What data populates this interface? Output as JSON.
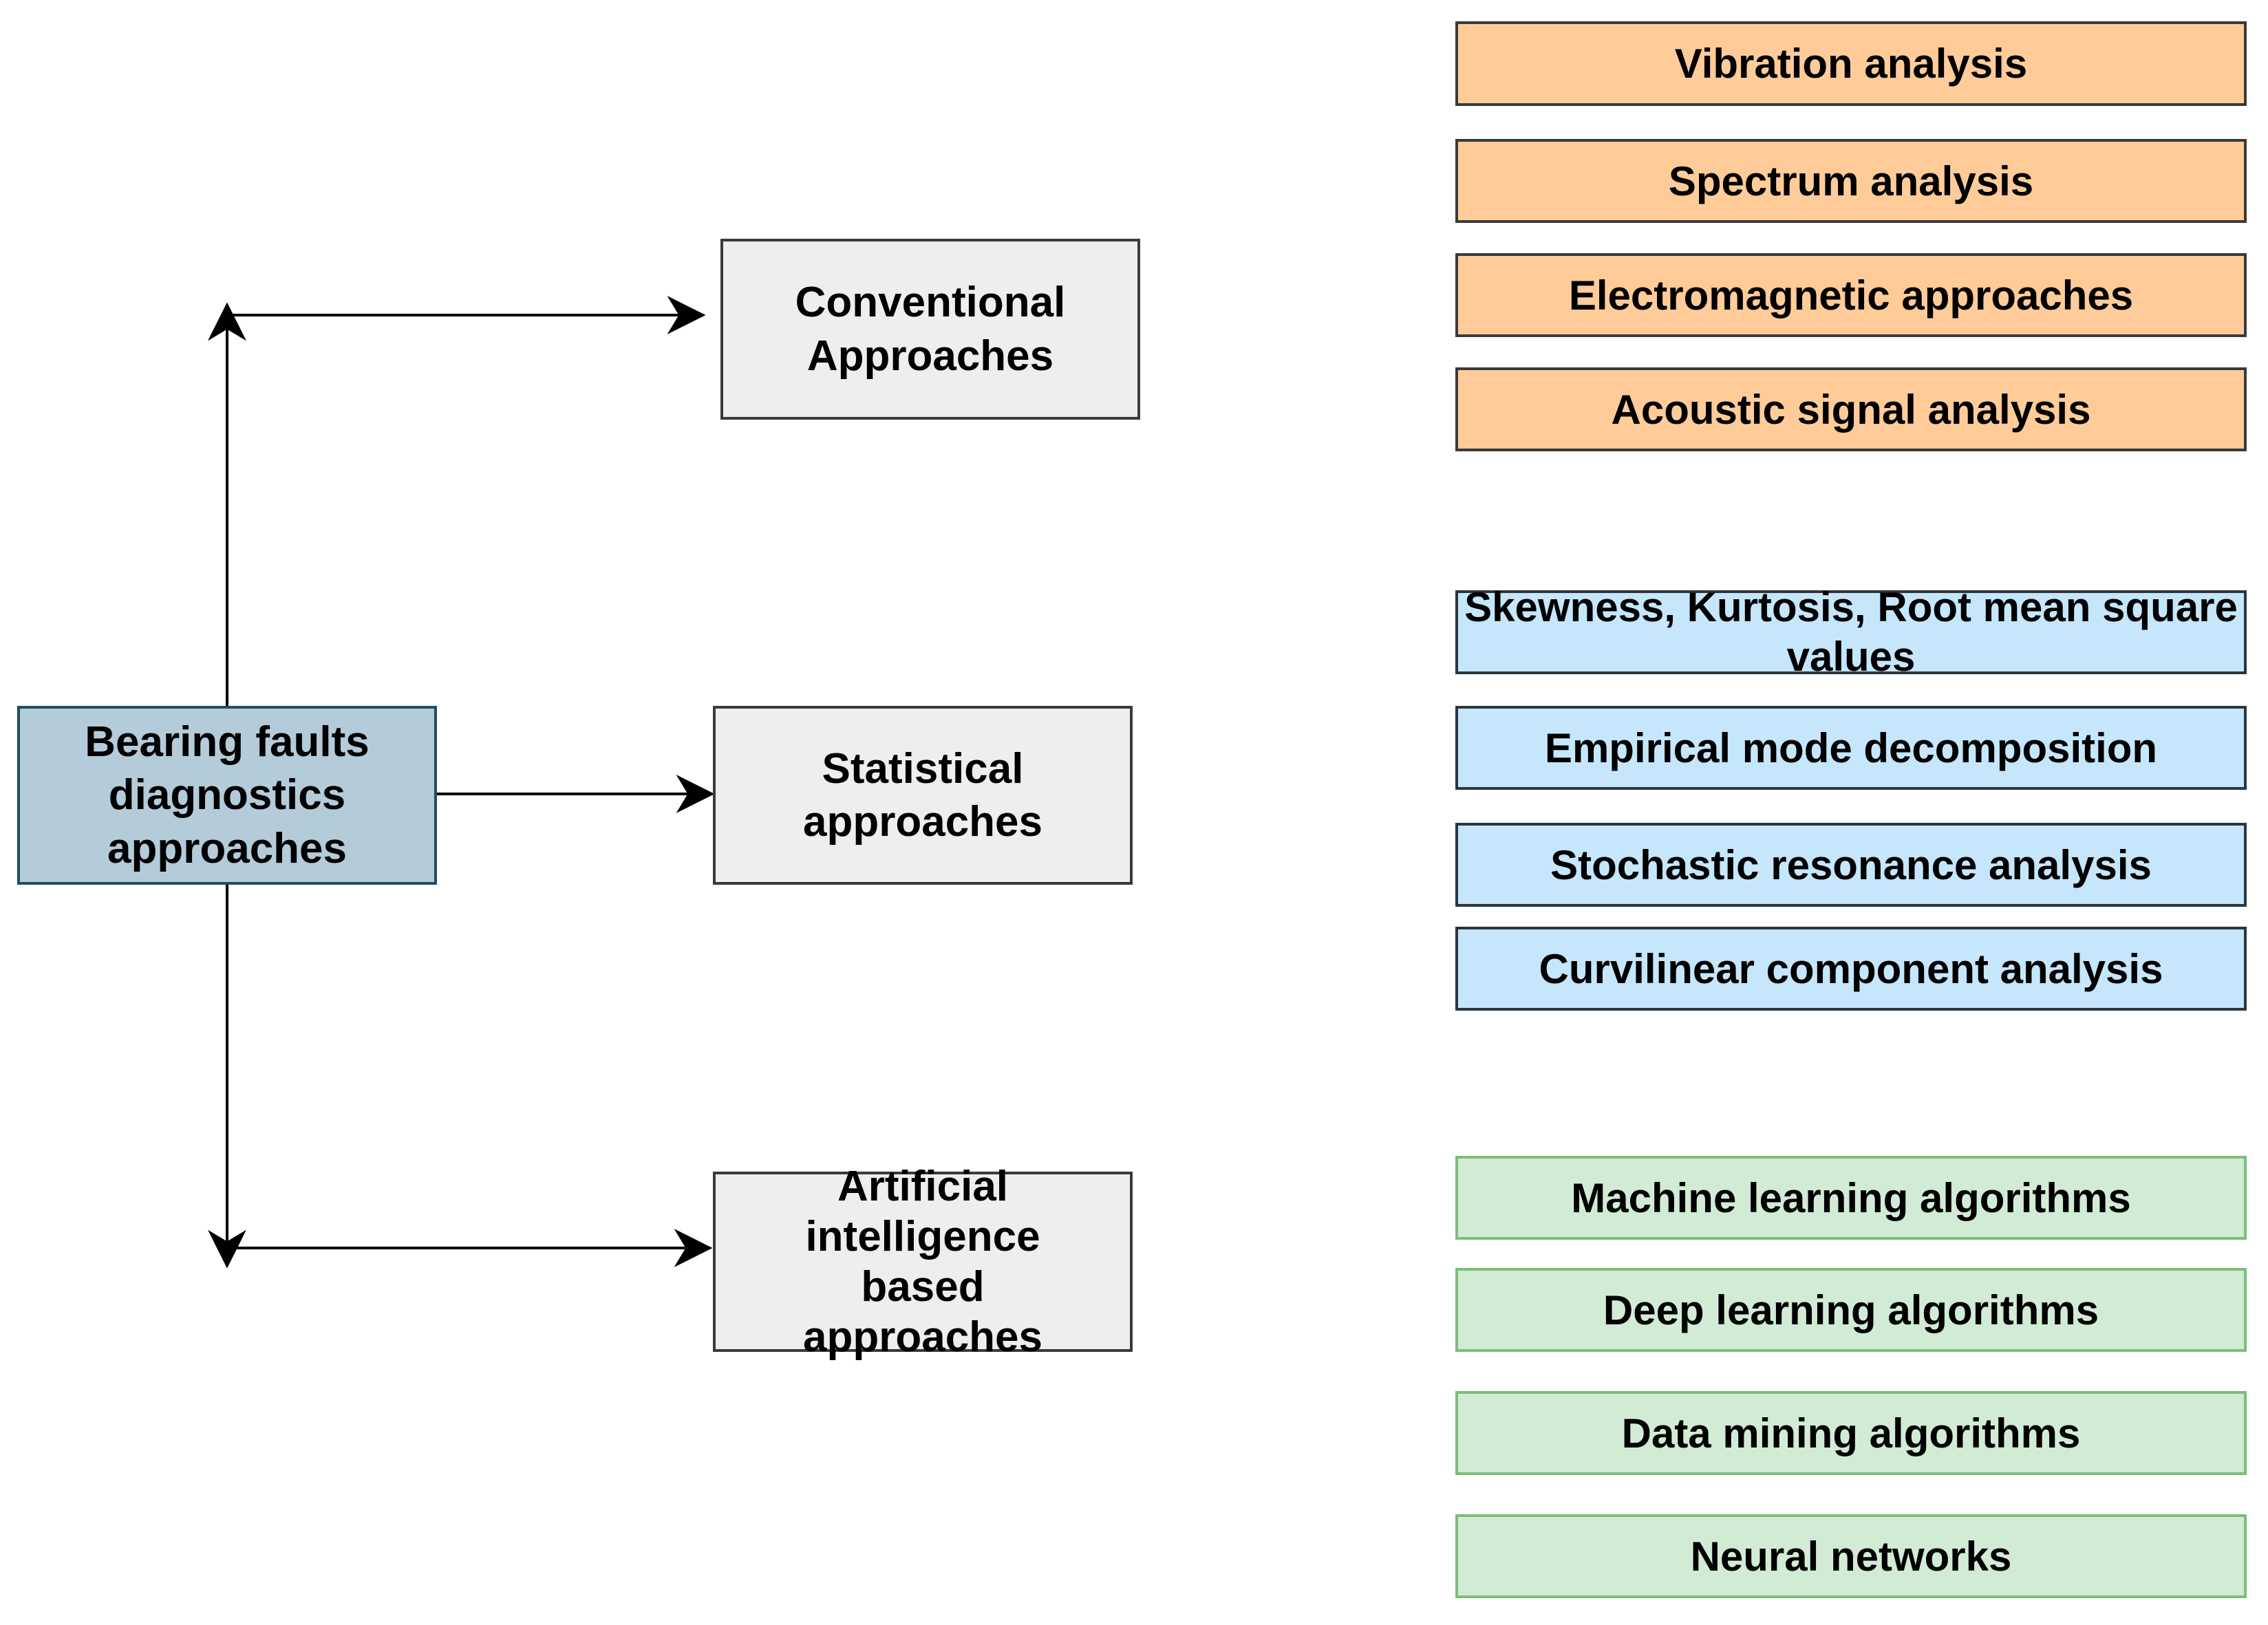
{
  "root": {
    "label": "Bearing faults diagnostics approaches"
  },
  "categories": [
    {
      "label": "Conventional Approaches"
    },
    {
      "label": "Statistical approaches"
    },
    {
      "label": "Artificial intelligence based approaches"
    }
  ],
  "groups": {
    "conventional": {
      "color": "#ffcc99",
      "items": [
        "Vibration analysis",
        "Spectrum analysis",
        "Electromagnetic approaches",
        "Acoustic signal analysis"
      ]
    },
    "statistical": {
      "color": "#c5e6fb",
      "items": [
        "Skewness, Kurtosis, Root mean square values",
        "Empirical mode decomposition",
        "Stochastic resonance analysis",
        "Curvilinear component analysis"
      ]
    },
    "ai": {
      "color": "#d2ebd5",
      "items": [
        "Machine learning algorithms",
        "Deep learning algorithms",
        "Data mining algorithms",
        "Neural networks"
      ]
    }
  }
}
